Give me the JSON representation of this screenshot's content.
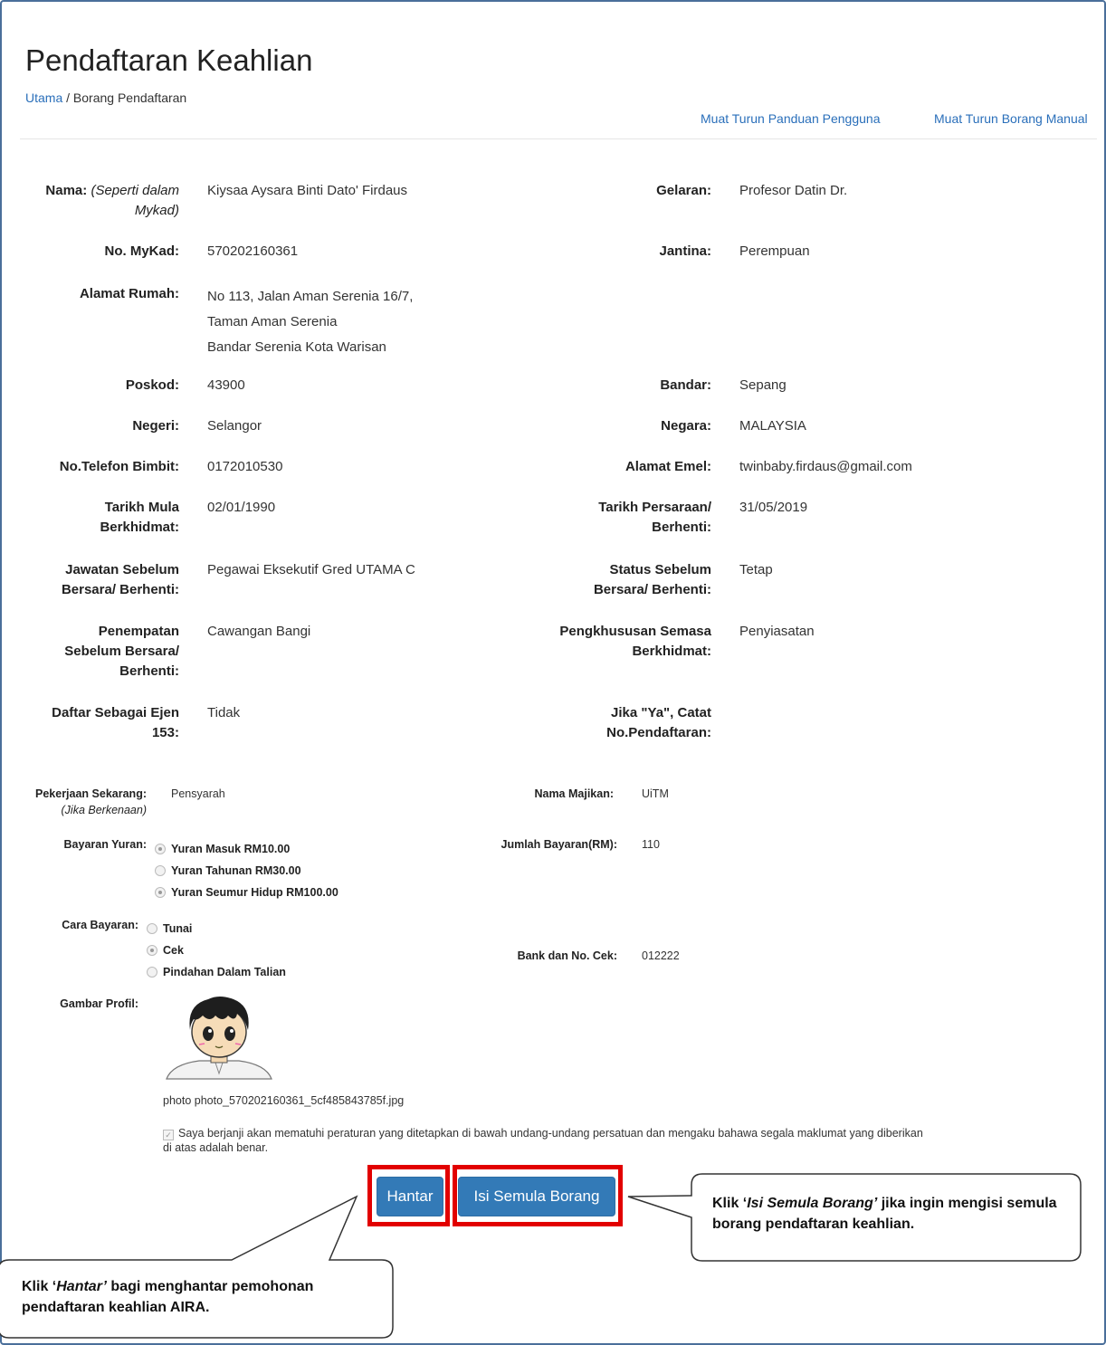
{
  "page": {
    "title": "Pendaftaran Keahlian",
    "breadcrumb": {
      "home": "Utama",
      "separator": " / ",
      "current": "Borang Pendaftaran"
    },
    "links": {
      "guide": "Muat Turun Panduan Pengguna",
      "manual_form": "Muat Turun Borang Manual"
    }
  },
  "profile": {
    "nama": {
      "label": "Nama:",
      "note": "(Seperti dalam Mykad)",
      "value": "Kiysaa Aysara Binti Dato' Firdaus"
    },
    "gelaran": {
      "label": "Gelaran:",
      "value": "Profesor Datin Dr."
    },
    "mykad": {
      "label": "No. MyKad:",
      "value": "570202160361"
    },
    "jantina": {
      "label": "Jantina:",
      "value": "Perempuan"
    },
    "alamat": {
      "label": "Alamat Rumah:",
      "line1": "No 113, Jalan Aman Serenia 16/7,",
      "line2": "Taman Aman Serenia",
      "line3": "Bandar Serenia Kota Warisan"
    },
    "poskod": {
      "label": "Poskod:",
      "value": "43900"
    },
    "bandar": {
      "label": "Bandar:",
      "value": "Sepang"
    },
    "negeri": {
      "label": "Negeri:",
      "value": "Selangor"
    },
    "negara": {
      "label": "Negara:",
      "value": "MALAYSIA"
    },
    "telefon": {
      "label": "No.Telefon Bimbit:",
      "value": "0172010530"
    },
    "emel": {
      "label": "Alamat Emel:",
      "value": "twinbaby.firdaus@gmail.com"
    },
    "tarikh_mula": {
      "label": "Tarikh Mula Berkhidmat:",
      "value": "02/01/1990"
    },
    "tarikh_bersara": {
      "label": "Tarikh Persaraan/ Berhenti:",
      "value": "31/05/2019"
    },
    "jawatan": {
      "label": "Jawatan Sebelum Bersara/ Berhenti:",
      "value": "Pegawai Eksekutif Gred UTAMA C"
    },
    "status": {
      "label": "Status Sebelum Bersara/ Berhenti:",
      "value": "Tetap"
    },
    "penempatan": {
      "label": "Penempatan Sebelum Bersara/ Berhenti:",
      "value": "Cawangan Bangi"
    },
    "pengkhususan": {
      "label": "Pengkhususan Semasa Berkhidmat:",
      "value": "Penyiasatan"
    },
    "ejen": {
      "label": "Daftar Sebagai Ejen 153:",
      "value": "Tidak"
    },
    "no_pendaftaran": {
      "label": "Jika \"Ya\", Catat No.Pendaftaran:",
      "value": ""
    }
  },
  "employment": {
    "pekerjaan": {
      "label": "Pekerjaan Sekarang:",
      "note": "(Jika Berkenaan)",
      "value": "Pensyarah"
    },
    "majikan": {
      "label": "Nama Majikan:",
      "value": "UiTM"
    },
    "bayaran_yuran": {
      "label": "Bayaran Yuran:",
      "options": [
        "Yuran Masuk RM10.00",
        "Yuran Tahunan RM30.00",
        "Yuran Seumur Hidup RM100.00"
      ],
      "selected": [
        0,
        2
      ]
    },
    "jumlah": {
      "label": "Jumlah Bayaran(RM):",
      "value": "110"
    },
    "cara_bayaran": {
      "label": "Cara Bayaran:",
      "options": [
        "Tunai",
        "Cek",
        "Pindahan Dalam Talian"
      ],
      "selected": 1
    },
    "bank": {
      "label": "Bank dan No. Cek:",
      "value": "012222"
    },
    "gambar": {
      "label": "Gambar Profil:",
      "filename": "photo photo_570202160361_5cf485843785f.jpg"
    },
    "declaration": "Saya berjanji akan mematuhi peraturan yang ditetapkan di bawah undang-undang persatuan dan mengaku bahawa segala maklumat yang diberikan di atas adalah benar."
  },
  "buttons": {
    "submit": "Hantar",
    "reset": "Isi Semula Borang"
  },
  "callouts": {
    "reset": {
      "prefix": "Klik ‘",
      "em": "Isi Semula Borang’",
      "rest": " jika ingin mengisi semula borang pendaftaran keahlian."
    },
    "submit": {
      "prefix": "Klik ‘",
      "em": "Hantar’",
      "rest": " bagi menghantar pemohonan pendaftaran keahlian AIRA."
    }
  },
  "colors": {
    "link": "#2a6fba",
    "button": "#337ab7",
    "highlight": "#e20000",
    "frame": "#4a6f9a"
  }
}
